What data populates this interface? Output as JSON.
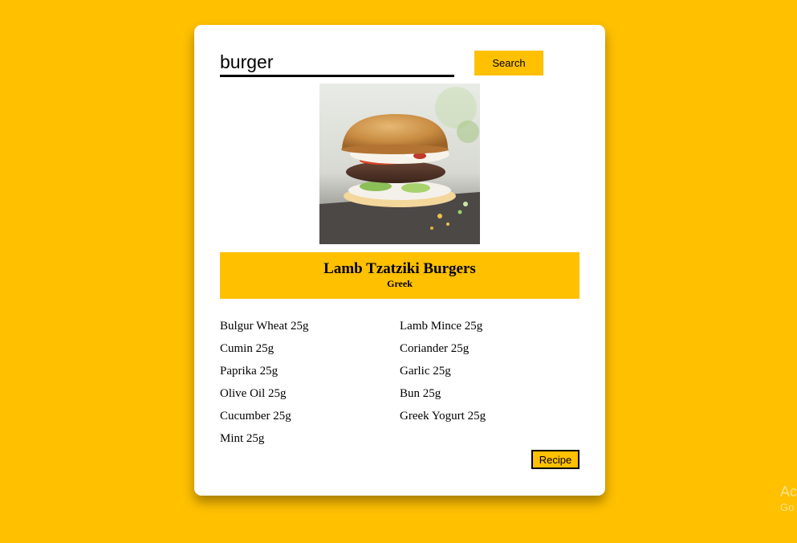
{
  "search": {
    "value": "burger",
    "button_label": "Search"
  },
  "recipe": {
    "image_alt": "burger photo",
    "title": "Lamb Tzatziki Burgers",
    "cuisine": "Greek",
    "ingredients": [
      "Bulgur Wheat 25g",
      "Lamb Mince 25g",
      "Cumin 25g",
      "Coriander 25g",
      "Paprika 25g",
      "Garlic 25g",
      "Olive Oil 25g",
      "Bun 25g",
      "Cucumber 25g",
      "Greek Yogurt 25g",
      "Mint 25g"
    ],
    "recipe_button_label": "Recipe"
  },
  "watermark": {
    "line1": "Ac",
    "line2": "Go"
  },
  "colors": {
    "background": "#FFC000",
    "card": "#FFFFFF",
    "accent": "#FFC000"
  }
}
